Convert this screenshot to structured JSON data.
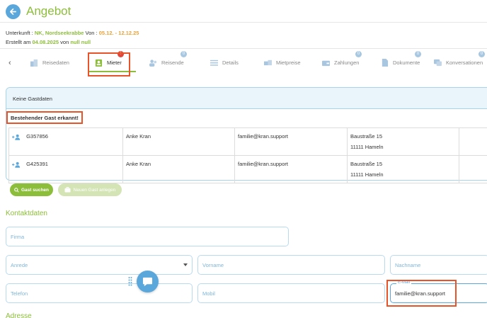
{
  "header": {
    "title": "Angebot"
  },
  "meta": {
    "accommodation_label": "Unterkunft : ",
    "accommodation_value": "NK, Nordseekrabbe",
    "from_label": " Von : ",
    "date_range": "05.12. - 12.12.25",
    "created_label": "Erstellt am ",
    "created_date": "04.08.2025",
    "by_label": " von ",
    "created_by": "null null"
  },
  "tabs": {
    "items": [
      {
        "label": "Reisedaten",
        "badge": ""
      },
      {
        "label": "Mieter",
        "badge": "!"
      },
      {
        "label": "Reisende",
        "badge": "0"
      },
      {
        "label": "Details",
        "badge": ""
      },
      {
        "label": "Mietpreise",
        "badge": ""
      },
      {
        "label": "Zahlungen",
        "badge": "0"
      },
      {
        "label": "Dokumente",
        "badge": "0"
      },
      {
        "label": "Konversationen",
        "badge": "0"
      }
    ]
  },
  "guest_panel": {
    "header": "Keine Gastdaten",
    "recognized": "Bestehender Gast erkannt!",
    "rows": [
      {
        "id": "G357856",
        "name": "Anke Kran",
        "email": "familie@kran.support",
        "street": "Baustraße 15",
        "city": "11111 Hameln"
      },
      {
        "id": "G425391",
        "name": "Anke Kran",
        "email": "familie@kran.support",
        "street": "Baustraße 15",
        "city": "11111 Hameln"
      }
    ],
    "search_button": "Gast suchen",
    "new_button": "Neuen Gast anlegen"
  },
  "contact": {
    "title": "Kontaktdaten",
    "firma_placeholder": "Firma",
    "anrede_placeholder": "Anrede",
    "vorname_placeholder": "Vorname",
    "nachname_placeholder": "Nachname",
    "telefon_placeholder": "Telefon",
    "mobil_placeholder": "Mobil",
    "email_label": "E-Mail",
    "email_value": "familie@kran.support"
  },
  "address": {
    "title": "Adresse"
  },
  "colors": {
    "accent_green": "#8dbe3b",
    "accent_blue": "#5aa7dc",
    "highlight_red": "#e8542a",
    "badge_red": "#e0463a"
  }
}
